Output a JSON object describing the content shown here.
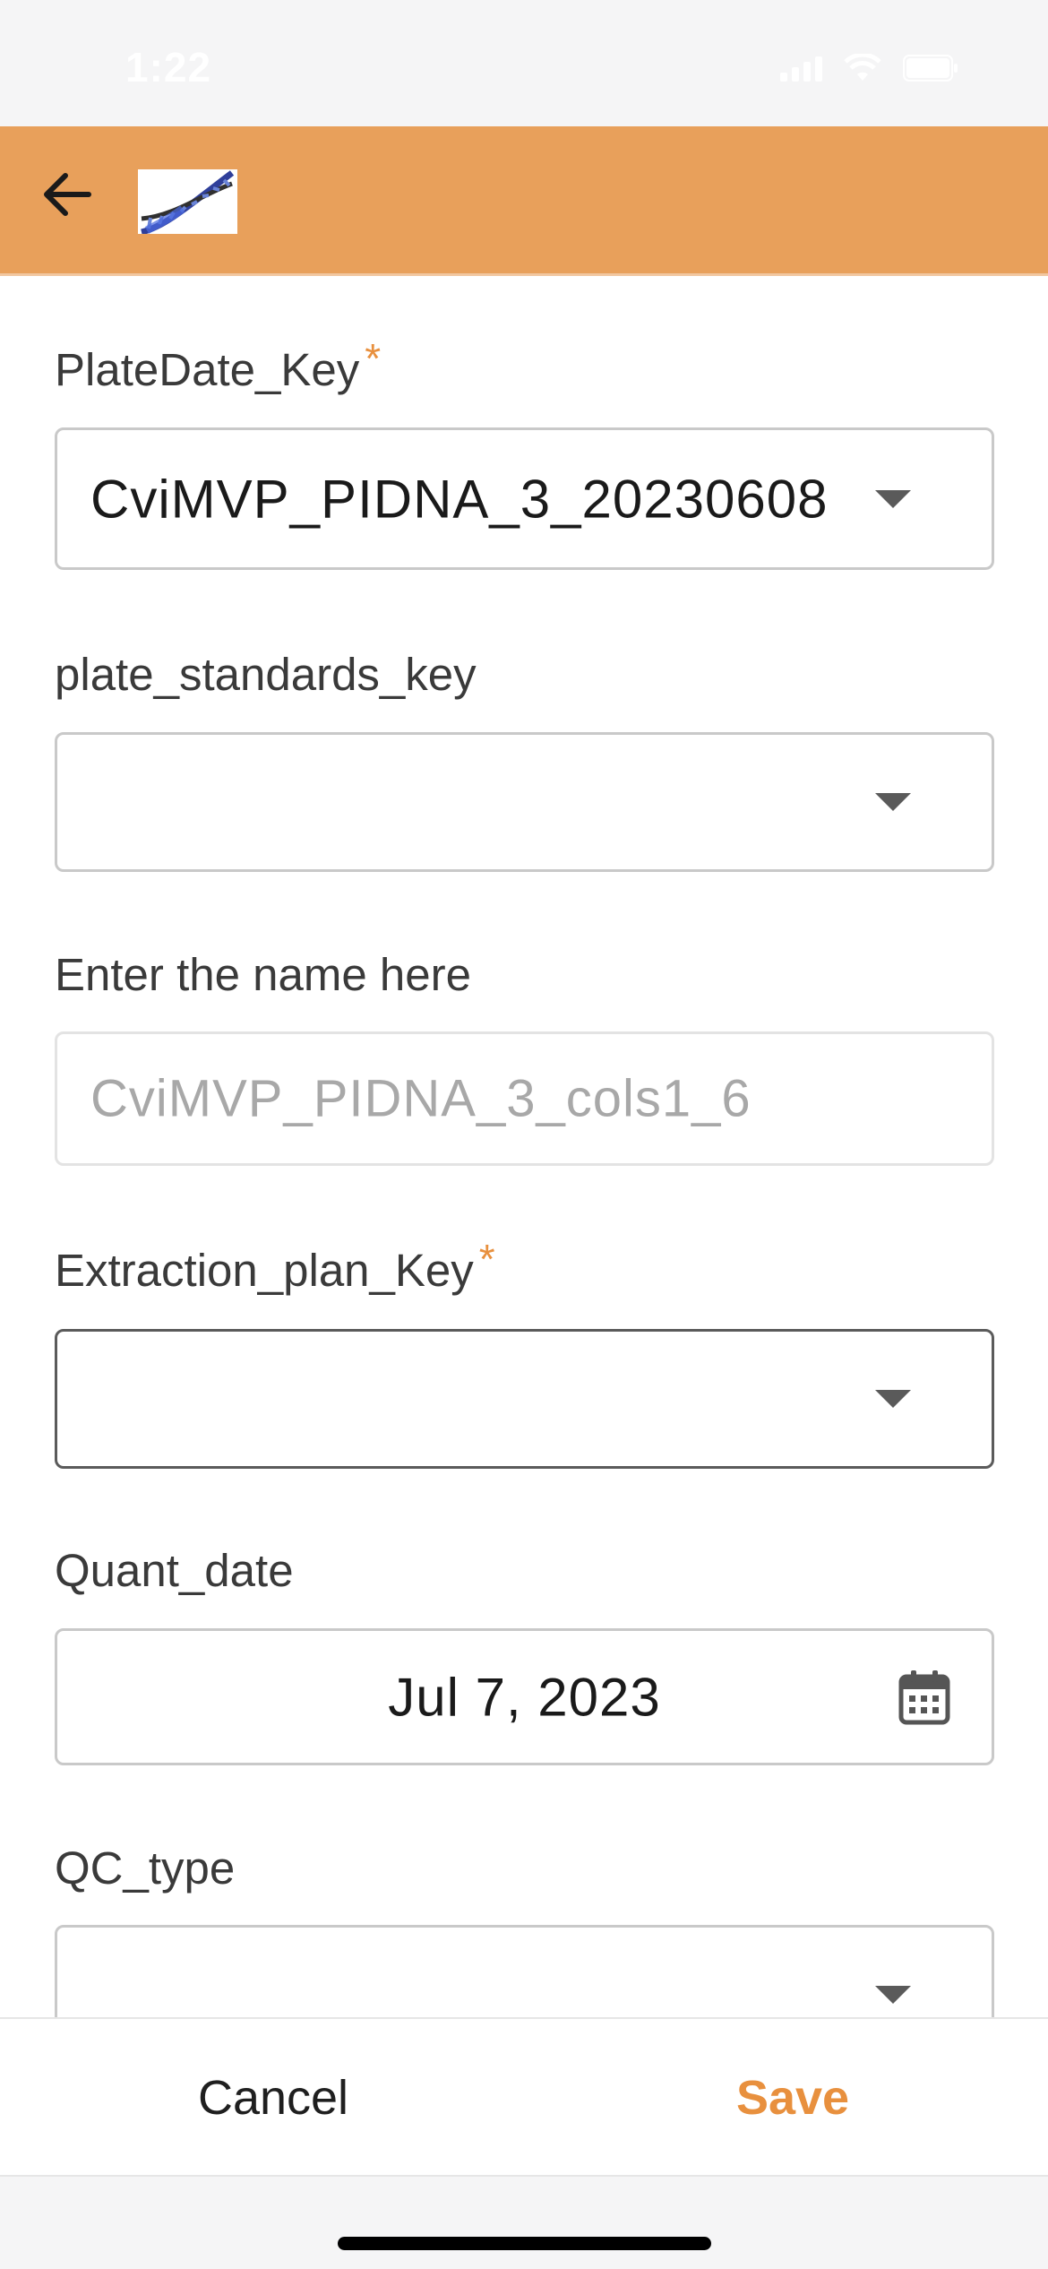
{
  "status_bar": {
    "time": "1:22"
  },
  "header": {
    "back_icon": "arrow-left-icon",
    "logo": "dna-helix-logo"
  },
  "form": {
    "plate_date_key": {
      "label": "PlateDate_Key",
      "required_mark": "*",
      "value": "CviMVP_PIDNA_3_20230608"
    },
    "plate_standards_key": {
      "label": "plate_standards_key",
      "value": ""
    },
    "name": {
      "label": "Enter the name here",
      "value": "CviMVP_PIDNA_3_cols1_6"
    },
    "extraction_plan_key": {
      "label": "Extraction_plan_Key",
      "required_mark": "*",
      "value": ""
    },
    "quant_date": {
      "label": "Quant_date",
      "value": "Jul 7, 2023",
      "icon": "calendar-icon"
    },
    "qc_type": {
      "label": "QC_type",
      "value": ""
    }
  },
  "actions": {
    "cancel_label": "Cancel",
    "save_label": "Save"
  },
  "colors": {
    "accent": "#e8a05b",
    "required": "#e8903e",
    "save": "#e8903e"
  }
}
